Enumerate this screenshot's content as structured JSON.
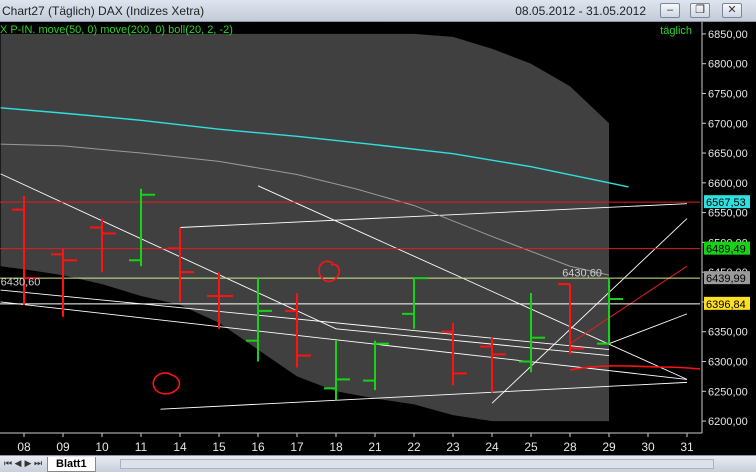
{
  "window": {
    "title": "Chart27 (Täglich)  DAX (Indizes Xetra)",
    "date_range": "08.05.2012 - 31.05.2012",
    "buttons": [
      "–",
      "❐",
      "✕"
    ]
  },
  "indicator_label": "X P-IN. move(50, 0) move(200, 0) boll(20, 2, -2)",
  "period_label": "täglich",
  "sheet_tab": "Blatt1",
  "colors": {
    "background": "#000000",
    "bollinger_band": "#404040",
    "up_candle": "#16d316",
    "down_candle": "#ff1212",
    "ma50": "#2ee0e0",
    "ma200": "#9a9a9a",
    "trendline": "#ffffff",
    "resistance": "#dd2020",
    "support_light": "#c8f08c"
  },
  "chart_data": {
    "type": "ohlc",
    "y_range": [
      6180,
      6870
    ],
    "y_ticks": [
      "6850,00",
      "6800,00",
      "6750,00",
      "6700,00",
      "6650,00",
      "6600,00",
      "6550,00",
      "6500,00",
      "6450,00",
      "6400,00",
      "6350,00",
      "6300,00",
      "6250,00",
      "6200,00"
    ],
    "x_labels": [
      "08",
      "09",
      "10",
      "11",
      "14",
      "15",
      "16",
      "17",
      "18",
      "21",
      "22",
      "23",
      "24",
      "25",
      "28",
      "29",
      "30",
      "31"
    ],
    "bars": [
      {
        "d": "08",
        "o": 6555,
        "h": 6578,
        "l": 6395,
        "c": 6440,
        "dir": "down"
      },
      {
        "d": "09",
        "o": 6480,
        "h": 6490,
        "l": 6375,
        "c": 6470,
        "dir": "down"
      },
      {
        "d": "10",
        "o": 6525,
        "h": 6540,
        "l": 6450,
        "c": 6515,
        "dir": "down"
      },
      {
        "d": "11",
        "o": 6470,
        "h": 6590,
        "l": 6460,
        "c": 6580,
        "dir": "up"
      },
      {
        "d": "14",
        "o": 6490,
        "h": 6525,
        "l": 6400,
        "c": 6450,
        "dir": "down"
      },
      {
        "d": "15",
        "o": 6410,
        "h": 6450,
        "l": 6355,
        "c": 6410,
        "dir": "down"
      },
      {
        "d": "16",
        "o": 6335,
        "h": 6440,
        "l": 6300,
        "c": 6385,
        "dir": "up"
      },
      {
        "d": "17",
        "o": 6385,
        "h": 6415,
        "l": 6290,
        "c": 6310,
        "dir": "down"
      },
      {
        "d": "18",
        "o": 6255,
        "h": 6335,
        "l": 6235,
        "c": 6270,
        "dir": "up"
      },
      {
        "d": "21",
        "o": 6268,
        "h": 6335,
        "l": 6252,
        "c": 6330,
        "dir": "up"
      },
      {
        "d": "22",
        "o": 6380,
        "h": 6440,
        "l": 6355,
        "c": 6440,
        "dir": "up"
      },
      {
        "d": "23",
        "o": 6350,
        "h": 6365,
        "l": 6260,
        "c": 6280,
        "dir": "down"
      },
      {
        "d": "24",
        "o": 6325,
        "h": 6340,
        "l": 6248,
        "c": 6312,
        "dir": "down"
      },
      {
        "d": "25",
        "o": 6300,
        "h": 6415,
        "l": 6282,
        "c": 6340,
        "dir": "up"
      },
      {
        "d": "28",
        "o": 6430,
        "h": 6430,
        "l": 6312,
        "c": 6322,
        "dir": "down"
      },
      {
        "d": "29",
        "o": 6330,
        "h": 6440,
        "l": 6330,
        "c": 6405,
        "dir": "up"
      }
    ],
    "ma50": [
      [
        -0.6,
        6726
      ],
      [
        1,
        6717
      ],
      [
        3,
        6705
      ],
      [
        5,
        6690
      ],
      [
        7,
        6678
      ],
      [
        9,
        6664
      ],
      [
        11,
        6649
      ],
      [
        13,
        6627
      ],
      [
        15,
        6600
      ],
      [
        15.5,
        6593
      ]
    ],
    "ma200": [
      [
        -0.6,
        6665
      ],
      [
        1,
        6662
      ],
      [
        3,
        6650
      ],
      [
        5,
        6636
      ],
      [
        7,
        6614
      ],
      [
        8.5,
        6590
      ],
      [
        10,
        6562
      ],
      [
        12,
        6510
      ],
      [
        14,
        6460
      ],
      [
        15,
        6445
      ]
    ],
    "bollinger_upper": [
      [
        -0.6,
        6850
      ],
      [
        2,
        6850
      ],
      [
        4,
        6850
      ],
      [
        6,
        6850
      ],
      [
        8,
        6850
      ],
      [
        9,
        6850
      ],
      [
        10,
        6850
      ],
      [
        11,
        6845
      ],
      [
        12,
        6825
      ],
      [
        13,
        6800
      ],
      [
        14,
        6762
      ],
      [
        15,
        6700
      ]
    ],
    "bollinger_lower": [
      [
        15,
        6200
      ],
      [
        14,
        6200
      ],
      [
        13,
        6200
      ],
      [
        12,
        6200
      ],
      [
        11,
        6210
      ],
      [
        10,
        6228
      ],
      [
        9,
        6238
      ],
      [
        8,
        6250
      ],
      [
        7,
        6275
      ],
      [
        6,
        6320
      ],
      [
        5,
        6365
      ],
      [
        4,
        6395
      ],
      [
        3,
        6410
      ],
      [
        2,
        6430
      ],
      [
        1,
        6445
      ],
      [
        0,
        6455
      ],
      [
        -0.6,
        6460
      ]
    ],
    "hlines": [
      {
        "y": 6567.53,
        "label": "6567,53",
        "color": "#dd2020",
        "label_bg": "#2ee0e0"
      },
      {
        "y": 6489.49,
        "label": "6489,49",
        "color": "#dd2020",
        "label_bg": "#16d316"
      },
      {
        "y": 6439.99,
        "label": "6439,99",
        "color": "#c8f08c",
        "label_bg": "#9a9a9a"
      },
      {
        "y": 6396.84,
        "label": "6396,84",
        "color": "#ffffff",
        "label_bg": "#ffe020"
      },
      {
        "y": 6180,
        "label": "",
        "color": "#dd2020",
        "label_bg": ""
      }
    ],
    "annotations": [
      {
        "text": "6430,60",
        "x": 13.8,
        "y": 6443,
        "color": "#cfcfcf"
      },
      {
        "text": "6430,60",
        "x": -0.6,
        "y": 6428,
        "color": "#cfcfcf"
      }
    ]
  }
}
